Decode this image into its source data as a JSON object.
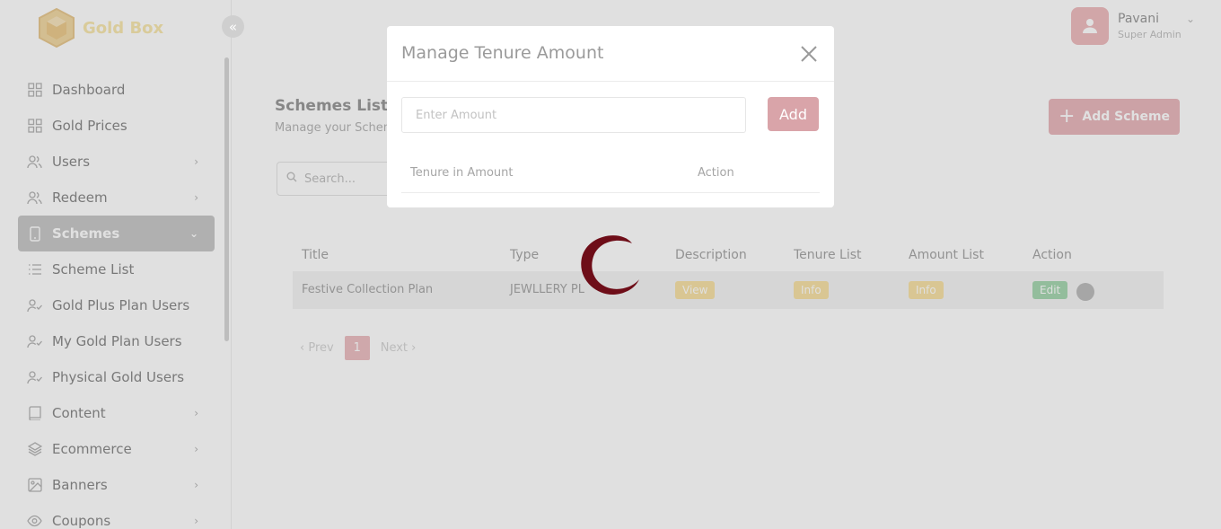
{
  "app": {
    "name": "Gold Box"
  },
  "colors": {
    "primary": "#7a0d1c",
    "sidebar_active": "#c9c9c9",
    "warning": "#f7e2a8",
    "success": "#a8d8b2"
  },
  "sidebar": {
    "collapse_icon": "double-chevron-left-icon",
    "items": [
      {
        "label": "Dashboard",
        "icon": "grid-icon",
        "has_chevron": false
      },
      {
        "label": "Gold Prices",
        "icon": "grid-icon",
        "has_chevron": false
      },
      {
        "label": "Users",
        "icon": "users-icon",
        "has_chevron": true
      },
      {
        "label": "Redeem",
        "icon": "users-icon",
        "has_chevron": true
      },
      {
        "label": "Schemes",
        "icon": "tablet-icon",
        "has_chevron": true,
        "active": true
      },
      {
        "label": "Scheme List",
        "icon": "list-icon",
        "has_chevron": false,
        "sub": true
      },
      {
        "label": "Gold Plus Plan Users",
        "icon": "user-check-icon",
        "has_chevron": false
      },
      {
        "label": "My Gold Plan Users",
        "icon": "user-check-icon",
        "has_chevron": false
      },
      {
        "label": "Physical Gold Users",
        "icon": "user-check-icon",
        "has_chevron": false
      },
      {
        "label": "Content",
        "icon": "book-icon",
        "has_chevron": true
      },
      {
        "label": "Ecommerce",
        "icon": "layers-icon",
        "has_chevron": true
      },
      {
        "label": "Banners",
        "icon": "image-icon",
        "has_chevron": true
      },
      {
        "label": "Coupons",
        "icon": "eye-icon",
        "has_chevron": true
      }
    ]
  },
  "header": {
    "user_name": "Pavani",
    "user_role": "Super Admin"
  },
  "main": {
    "title": "Schemes List",
    "subtitle": "Manage your Schem",
    "add_button": "Add Scheme",
    "search_placeholder": "Search...",
    "table": {
      "headers": [
        "Title",
        "Type",
        "Description",
        "Tenure List",
        "Amount List",
        "Action"
      ],
      "rows": [
        {
          "title": "Festive Collection Plan",
          "type": "JEWLLERY PL",
          "description": "View",
          "tenure": "Info",
          "amount": "Info",
          "action": "Edit"
        }
      ]
    },
    "pagination": {
      "prev": "Prev",
      "current": "1",
      "next": "Next"
    }
  },
  "modal": {
    "title": "Manage Tenure Amount",
    "input_placeholder": "Enter Amount",
    "add_label": "Add",
    "table_headers": [
      "Tenure in Amount",
      "Action"
    ]
  }
}
